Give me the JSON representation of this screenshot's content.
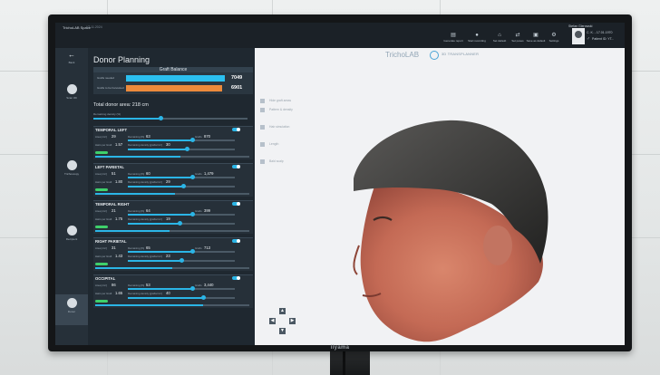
{
  "app": {
    "title": "TrichoLAB Space",
    "version": "V2.11.2024"
  },
  "toolbar": [
    {
      "label": "Generate report",
      "icon": "report-icon"
    },
    {
      "label": "Start recording",
      "icon": "record-icon"
    },
    {
      "label": "Set default",
      "icon": "default-icon"
    },
    {
      "label": "Set poses",
      "icon": "poses-icon"
    },
    {
      "label": "Save as default",
      "icon": "save-icon"
    },
    {
      "label": "Settings",
      "icon": "gear-icon"
    }
  ],
  "patient": {
    "user": "Stefan Gierowski",
    "dob": "C. K. - 17.01.1970",
    "id": "Patient ID: YT..."
  },
  "nav": [
    {
      "label": "Back",
      "icon": "back-arrow-icon"
    },
    {
      "label": "Scan 3D",
      "icon": "scan-icon"
    },
    {
      "label": "Trichoscopy",
      "icon": "trichoscopy-icon"
    },
    {
      "label": "Recipient",
      "icon": "recipient-icon"
    },
    {
      "label": "Donor",
      "icon": "donor-icon"
    }
  ],
  "donor": {
    "title": "Donor Planning",
    "graft_balance": {
      "title": "Graft Balance",
      "rows": [
        {
          "label": "Grafts needed",
          "value": "7049",
          "fraction": 0.97,
          "color": "#2bbfef"
        },
        {
          "label": "Grafts to be harvested",
          "value": "6901",
          "fraction": 0.95,
          "color": "#ec8a3b"
        }
      ]
    },
    "total_area": "Total donor area: 218 cm",
    "remaining_density_label": "Remaining density (%)",
    "labels": {
      "area": "Area [cm²]",
      "remaining": "Remaining [%]",
      "grafts": "Grafts",
      "hairs_per_graft": "Hairs per Graft",
      "remaining_density": "Remaining density [grafts/cm²]"
    },
    "areas": [
      {
        "name": "TEMPORAL LEFT",
        "area": "29",
        "hpg": "1.57",
        "remaining": "63",
        "grafts": "870",
        "density": "30",
        "fraction": 0.55
      },
      {
        "name": "LEFT PARIETAL",
        "area": "51",
        "hpg": "1.80",
        "remaining": "60",
        "grafts": "1,479",
        "density": "29",
        "fraction": 0.52
      },
      {
        "name": "TEMPORAL RIGHT",
        "area": "21",
        "hpg": "1.75",
        "remaining": "64",
        "grafts": "399",
        "density": "19",
        "fraction": 0.48
      },
      {
        "name": "RIGHT PARIETAL",
        "area": "31",
        "hpg": "1.43",
        "remaining": "65",
        "grafts": "713",
        "density": "23",
        "fraction": 0.5
      },
      {
        "name": "OCCIPITAL",
        "area": "86",
        "hpg": "1.65",
        "remaining": "53",
        "grafts": "3,440",
        "density": "40",
        "fraction": 0.7
      }
    ]
  },
  "planner": {
    "logo": "TrichoLAB",
    "subtitle": "3D TRANSPLANNER",
    "tools": [
      "Hide graft areas",
      "Pattern & density",
      "Hair simulation",
      "Length",
      "Bald scalp"
    ]
  },
  "monitor": {
    "brand": "iiyama"
  },
  "colors": {
    "accent": "#2bb5e6",
    "orange": "#ec8a3b",
    "toggle_green": "#3fd06b"
  }
}
